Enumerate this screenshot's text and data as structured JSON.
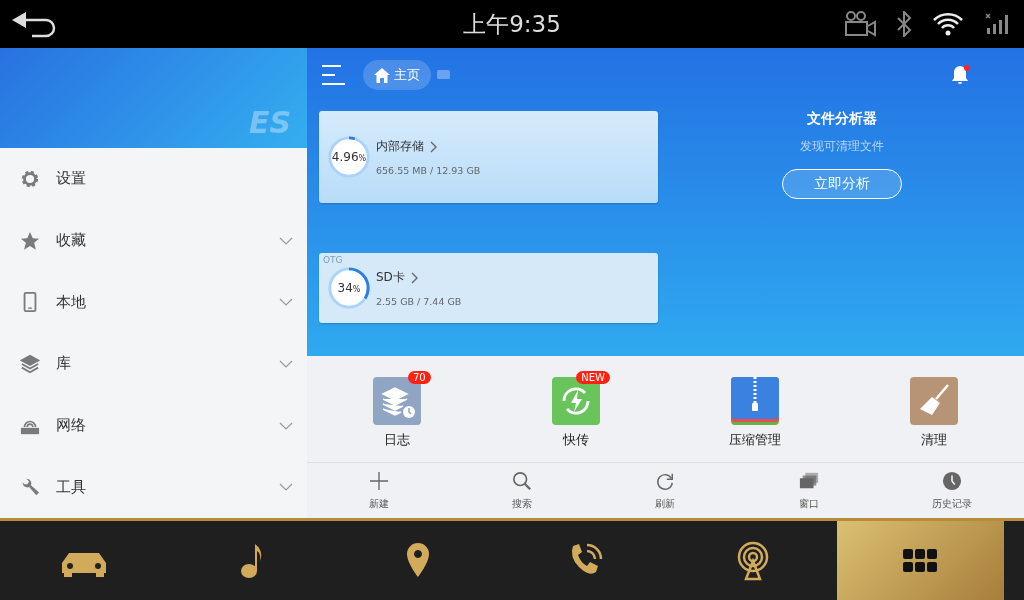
{
  "status_bar": {
    "time": "上午9:35"
  },
  "sidebar": {
    "logo": "ES",
    "items": [
      {
        "label": "设置",
        "kind": "gear",
        "expandable": false
      },
      {
        "label": "收藏",
        "kind": "star",
        "expandable": true
      },
      {
        "label": "本地",
        "kind": "phone",
        "expandable": true
      },
      {
        "label": "库",
        "kind": "layers",
        "expandable": true
      },
      {
        "label": "网络",
        "kind": "router",
        "expandable": true
      },
      {
        "label": "工具",
        "kind": "wrench",
        "expandable": true
      }
    ]
  },
  "header": {
    "home": "主页",
    "notification": true
  },
  "storage": [
    {
      "name": "内部存储",
      "percent": "4.96",
      "unit": "%",
      "usage": "656.55 MB / 12.93 GB",
      "level": 0.0496
    },
    {
      "name": "SD卡",
      "tag": "OTG",
      "percent": "34",
      "unit": "%",
      "usage": "2.55 GB / 7.44 GB",
      "level": 0.34
    }
  ],
  "analyzer": {
    "title": "文件分析器",
    "subtitle": "发现可清理文件",
    "button": "立即分析"
  },
  "tools": [
    {
      "label": "日志",
      "kind": "log",
      "badge": "70"
    },
    {
      "label": "快传",
      "kind": "transfer",
      "badge": "NEW"
    },
    {
      "label": "压缩管理",
      "kind": "zip"
    },
    {
      "label": "清理",
      "kind": "clean"
    }
  ],
  "toolbar": [
    {
      "label": "新建",
      "kind": "new"
    },
    {
      "label": "搜索",
      "kind": "search"
    },
    {
      "label": "刷新",
      "kind": "refresh"
    },
    {
      "label": "窗口",
      "kind": "windows"
    },
    {
      "label": "历史记录",
      "kind": "history"
    }
  ],
  "dock": [
    {
      "kind": "car",
      "selected": false
    },
    {
      "kind": "music",
      "selected": false
    },
    {
      "kind": "location",
      "selected": false
    },
    {
      "kind": "phone",
      "selected": false
    },
    {
      "kind": "radio",
      "selected": false
    },
    {
      "kind": "apps",
      "selected": true
    }
  ]
}
